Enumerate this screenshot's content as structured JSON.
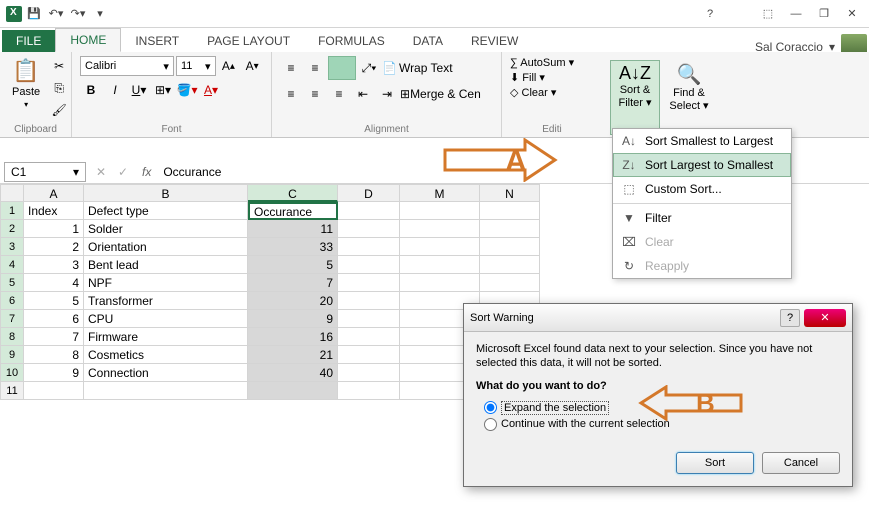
{
  "titlebar": {
    "user": "Sal Coraccio"
  },
  "tabs": {
    "file": "FILE",
    "home": "HOME",
    "insert": "INSERT",
    "pagelayout": "PAGE LAYOUT",
    "formulas": "FORMULAS",
    "data": "DATA",
    "review": "REVIEW"
  },
  "ribbon": {
    "clipboard": {
      "label": "Clipboard",
      "paste": "Paste"
    },
    "font": {
      "label": "Font",
      "name": "Calibri",
      "size": "11"
    },
    "alignment": {
      "label": "Alignment",
      "wrap": "Wrap Text",
      "merge": "Merge & Cen"
    },
    "editing": {
      "label": "Editi",
      "autosum": "AutoSum",
      "fill": "Fill",
      "clear": "Clear",
      "sort": "Sort &",
      "filter": "Filter",
      "find": "Find &",
      "select": "Select"
    }
  },
  "dropdown": {
    "smallest": "Sort Smallest to Largest",
    "largest": "Sort Largest to Smallest",
    "custom": "Custom Sort...",
    "filter": "Filter",
    "clear": "Clear",
    "reapply": "Reapply"
  },
  "namebox": "C1",
  "formula": "Occurance",
  "columns": [
    "A",
    "B",
    "C",
    "D",
    "M",
    "N"
  ],
  "headers": {
    "a": "Index",
    "b": "Defect type",
    "c": "Occurance"
  },
  "rows": [
    {
      "idx": 1,
      "type": "Solder",
      "occ": 11
    },
    {
      "idx": 2,
      "type": "Orientation",
      "occ": 33
    },
    {
      "idx": 3,
      "type": "Bent lead",
      "occ": 5
    },
    {
      "idx": 4,
      "type": "NPF",
      "occ": 7
    },
    {
      "idx": 5,
      "type": "Transformer",
      "occ": 20
    },
    {
      "idx": 6,
      "type": "CPU",
      "occ": 9
    },
    {
      "idx": 7,
      "type": "Firmware",
      "occ": 16
    },
    {
      "idx": 8,
      "type": "Cosmetics",
      "occ": 21
    },
    {
      "idx": 9,
      "type": "Connection",
      "occ": 40
    }
  ],
  "dialog": {
    "title": "Sort Warning",
    "msg": "Microsoft Excel found data next to your selection.  Since you have not selected this data, it will not be sorted.",
    "prompt": "What do you want to do?",
    "opt1": "Expand the selection",
    "opt2": "Continue with the current selection",
    "sort": "Sort",
    "cancel": "Cancel"
  },
  "annotations": {
    "a": "A",
    "b": "B"
  }
}
